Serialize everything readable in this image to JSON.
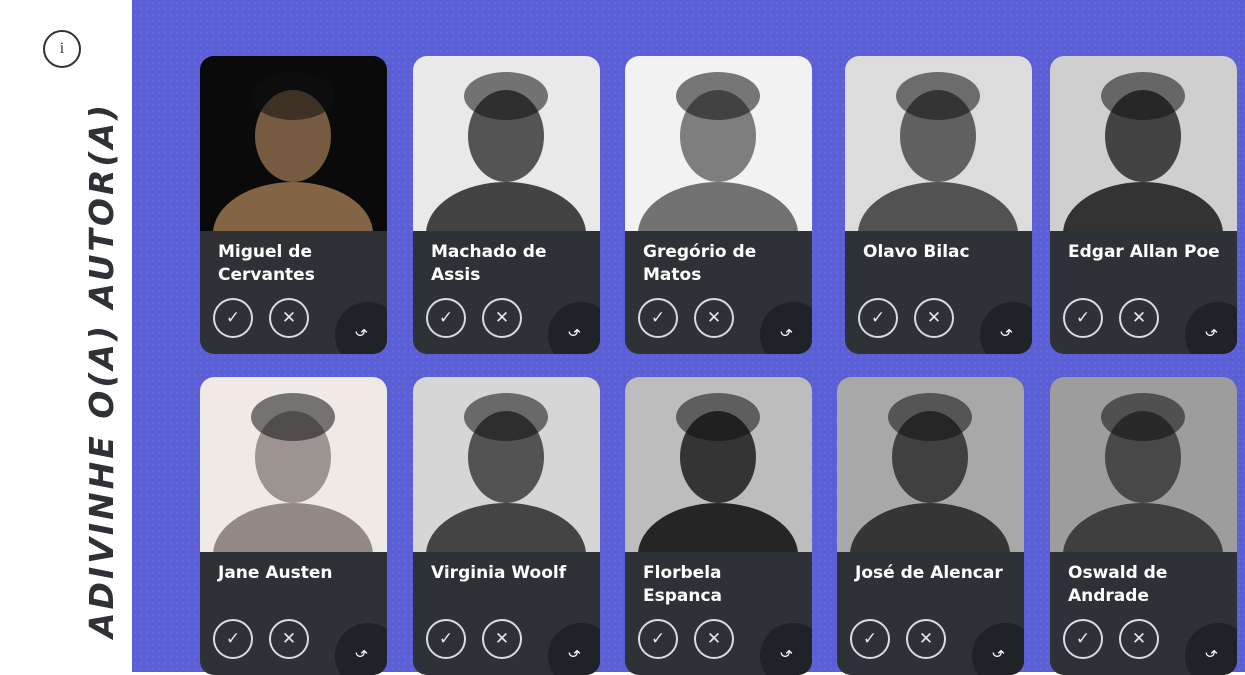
{
  "sidebar": {
    "title": "ADIVINHE O(A) AUTOR(A)",
    "info_glyph": "i",
    "info_icon": "info-icon"
  },
  "card_labels": {
    "correct_glyph": "✓",
    "wrong_glyph": "✕",
    "flip_glyph": "↶"
  },
  "cards": [
    {
      "name": "Miguel de Cervantes",
      "bg": "#0a0a0a",
      "tone": "#8a6a4a"
    },
    {
      "name": "Machado de Assis",
      "bg": "#e9e9e9",
      "tone": "#3a3a3a"
    },
    {
      "name": "Gregório de Matos",
      "bg": "#f2f2f2",
      "tone": "#6a6a6a"
    },
    {
      "name": "Olavo Bilac",
      "bg": "#dcdcdc",
      "tone": "#4a4a4a"
    },
    {
      "name": "Edgar Allan Poe",
      "bg": "#cfcfcf",
      "tone": "#2a2a2a"
    },
    {
      "name": "Jane Austen",
      "bg": "#efeae6",
      "tone": "#8d8580"
    },
    {
      "name": "Virginia Woolf",
      "bg": "#d6d6d6",
      "tone": "#3c3c3c"
    },
    {
      "name": "Florbela Espanca",
      "bg": "#bdbdbd",
      "tone": "#1c1c1c"
    },
    {
      "name": "José de Alencar",
      "bg": "#a8a8a8",
      "tone": "#2e2e2e"
    },
    {
      "name": "Oswald de Andrade",
      "bg": "#9d9d9d",
      "tone": "#3a3a3a"
    }
  ],
  "colors": {
    "board": "#5b5fd6",
    "card": "#2e3236",
    "flip": "#1f2226"
  }
}
